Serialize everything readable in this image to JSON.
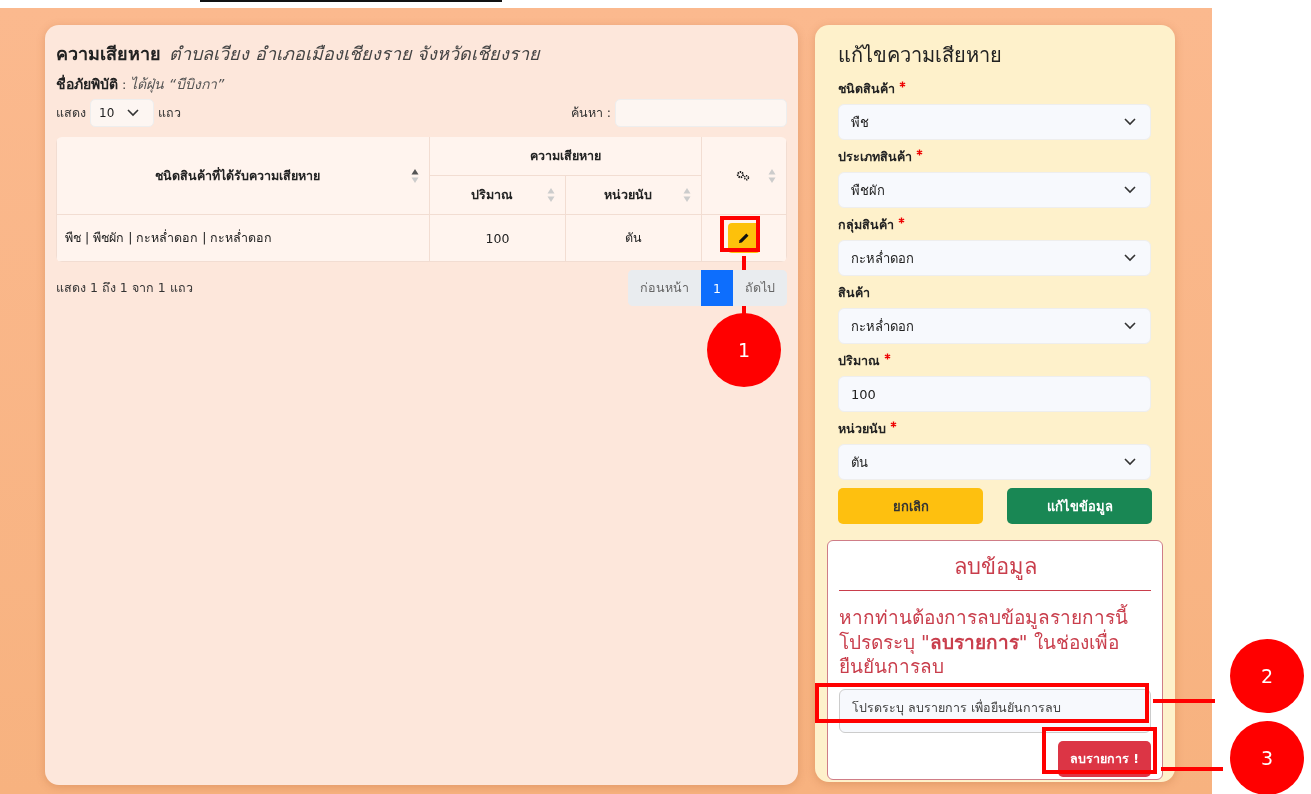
{
  "left_panel": {
    "heading": "ความเสียหาย",
    "location": "ตำบลเวียง อำเภอเมืองเชียงราย จังหวัดเชียงราย",
    "disaster_label": "ชื่อภัยพิบัติ",
    "disaster_separator": ":",
    "disaster_name": "ไต้ฝุ่น “บีบิงกา”",
    "length_prefix": "แสดง",
    "length_value": "10",
    "length_suffix": "แถว",
    "search_label": "ค้นหา :",
    "table": {
      "columns": [
        {
          "kind": "text",
          "label": "ชนิดสินค้าที่ได้รับความเสียหาย",
          "sorted": true
        },
        {
          "kind": "group",
          "label": "ความเสียหาย",
          "children": [
            {
              "label": "ปริมาณ",
              "sorted": false
            },
            {
              "label": "หน่วยนับ",
              "sorted": false
            }
          ]
        },
        {
          "kind": "actions",
          "sorted": false
        }
      ],
      "rows": [
        {
          "product": "พืช | พืชผัก | กะหล่ำดอก | กะหล่ำดอก",
          "quantity": "100",
          "unit": "ตัน"
        }
      ]
    },
    "info": "แสดง 1 ถึง 1 จาก 1 แถว",
    "pagination": [
      {
        "label": "ก่อนหน้า",
        "selected": false
      },
      {
        "label": "1",
        "selected": true
      },
      {
        "label": "ถัดไป",
        "selected": false
      }
    ]
  },
  "right_panel": {
    "title": "แก้ไขความเสียหาย",
    "fields": [
      {
        "label": "ชนิดสินค้า",
        "required": true,
        "kind": "select",
        "value": "พืช"
      },
      {
        "label": "ประเภทสินค้า",
        "required": true,
        "kind": "select",
        "value": "พืชผัก"
      },
      {
        "label": "กลุ่มสินค้า",
        "required": true,
        "kind": "select",
        "value": "กะหล่ำดอก"
      },
      {
        "label": "สินค้า",
        "required": false,
        "kind": "select",
        "value": "กะหล่ำดอก"
      },
      {
        "label": "ปริมาณ",
        "required": true,
        "kind": "input",
        "value": "100"
      },
      {
        "label": "หน่วยนับ",
        "required": true,
        "kind": "select",
        "value": "ตัน"
      }
    ],
    "cancel_button": "ยกเลิก",
    "save_button": "แก้ไขข้อมูล",
    "delete_box": {
      "title": "ลบข้อมูล",
      "message": "หากท่านต้องการลบข้อมูลรายการนี้ โปรดระบุ \"**ลบรายการ**\" ในช่องเพื่อยืนยันการลบ",
      "placeholder": "โปรดระบุ ลบรายการ เพื่อยืนยันการลบ",
      "button": "ลบรายการ !"
    }
  },
  "annotations": [
    {
      "number": "1",
      "kind": "edit"
    },
    {
      "number": "2",
      "kind": "confirm"
    },
    {
      "number": "3",
      "kind": "delete"
    }
  ]
}
